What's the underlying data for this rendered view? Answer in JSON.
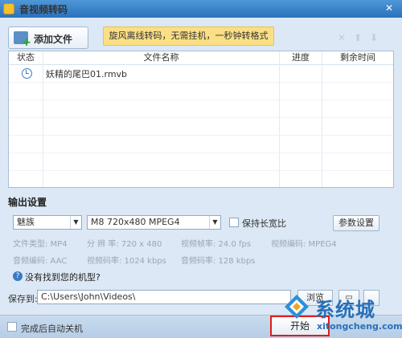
{
  "window": {
    "title": "音视频转码",
    "close_glyph": "✕"
  },
  "toolbar": {
    "add_file_label": "添加文件",
    "promo_text": "旋风离线转码，无需挂机，一秒钟转格式",
    "icons": [
      "delete-icon",
      "move-up-icon",
      "move-down-icon"
    ]
  },
  "table": {
    "headers": {
      "status": "状态",
      "file_name": "文件名称",
      "progress": "进度",
      "remaining": "剩余时间"
    },
    "rows": [
      {
        "status_icon": "clock-icon",
        "file_name": "妖精的尾巴01.rmvb",
        "progress": "",
        "remaining": ""
      }
    ]
  },
  "output": {
    "section_title": "输出设置",
    "device": "魅族",
    "format": "M8 720x480 MPEG4",
    "keep_ratio_label": "保持长宽比",
    "param_button": "参数设置",
    "specs": {
      "file_type": "文件类型:  MP4",
      "resolution": "分 辨 率:   720 x 480",
      "video_fps": "视频帧率:  24.0 fps",
      "video_codec": "视频编码:   MPEG4",
      "audio_codec": "音频编码:  AAC",
      "video_bitrate": "视频码率:  1024 kbps",
      "audio_bitrate": "音频码率:  128 kbps"
    },
    "help_text": "没有找到您的机型?"
  },
  "save": {
    "label": "保存到:",
    "path": "C:\\Users\\John\\Videos\\",
    "browse_label": "浏览"
  },
  "bottom": {
    "auto_shutdown_label": "完成后自动关机",
    "convert_label": "开始"
  },
  "watermark": {
    "text": "系统城",
    "url": "xitongcheng.com"
  }
}
